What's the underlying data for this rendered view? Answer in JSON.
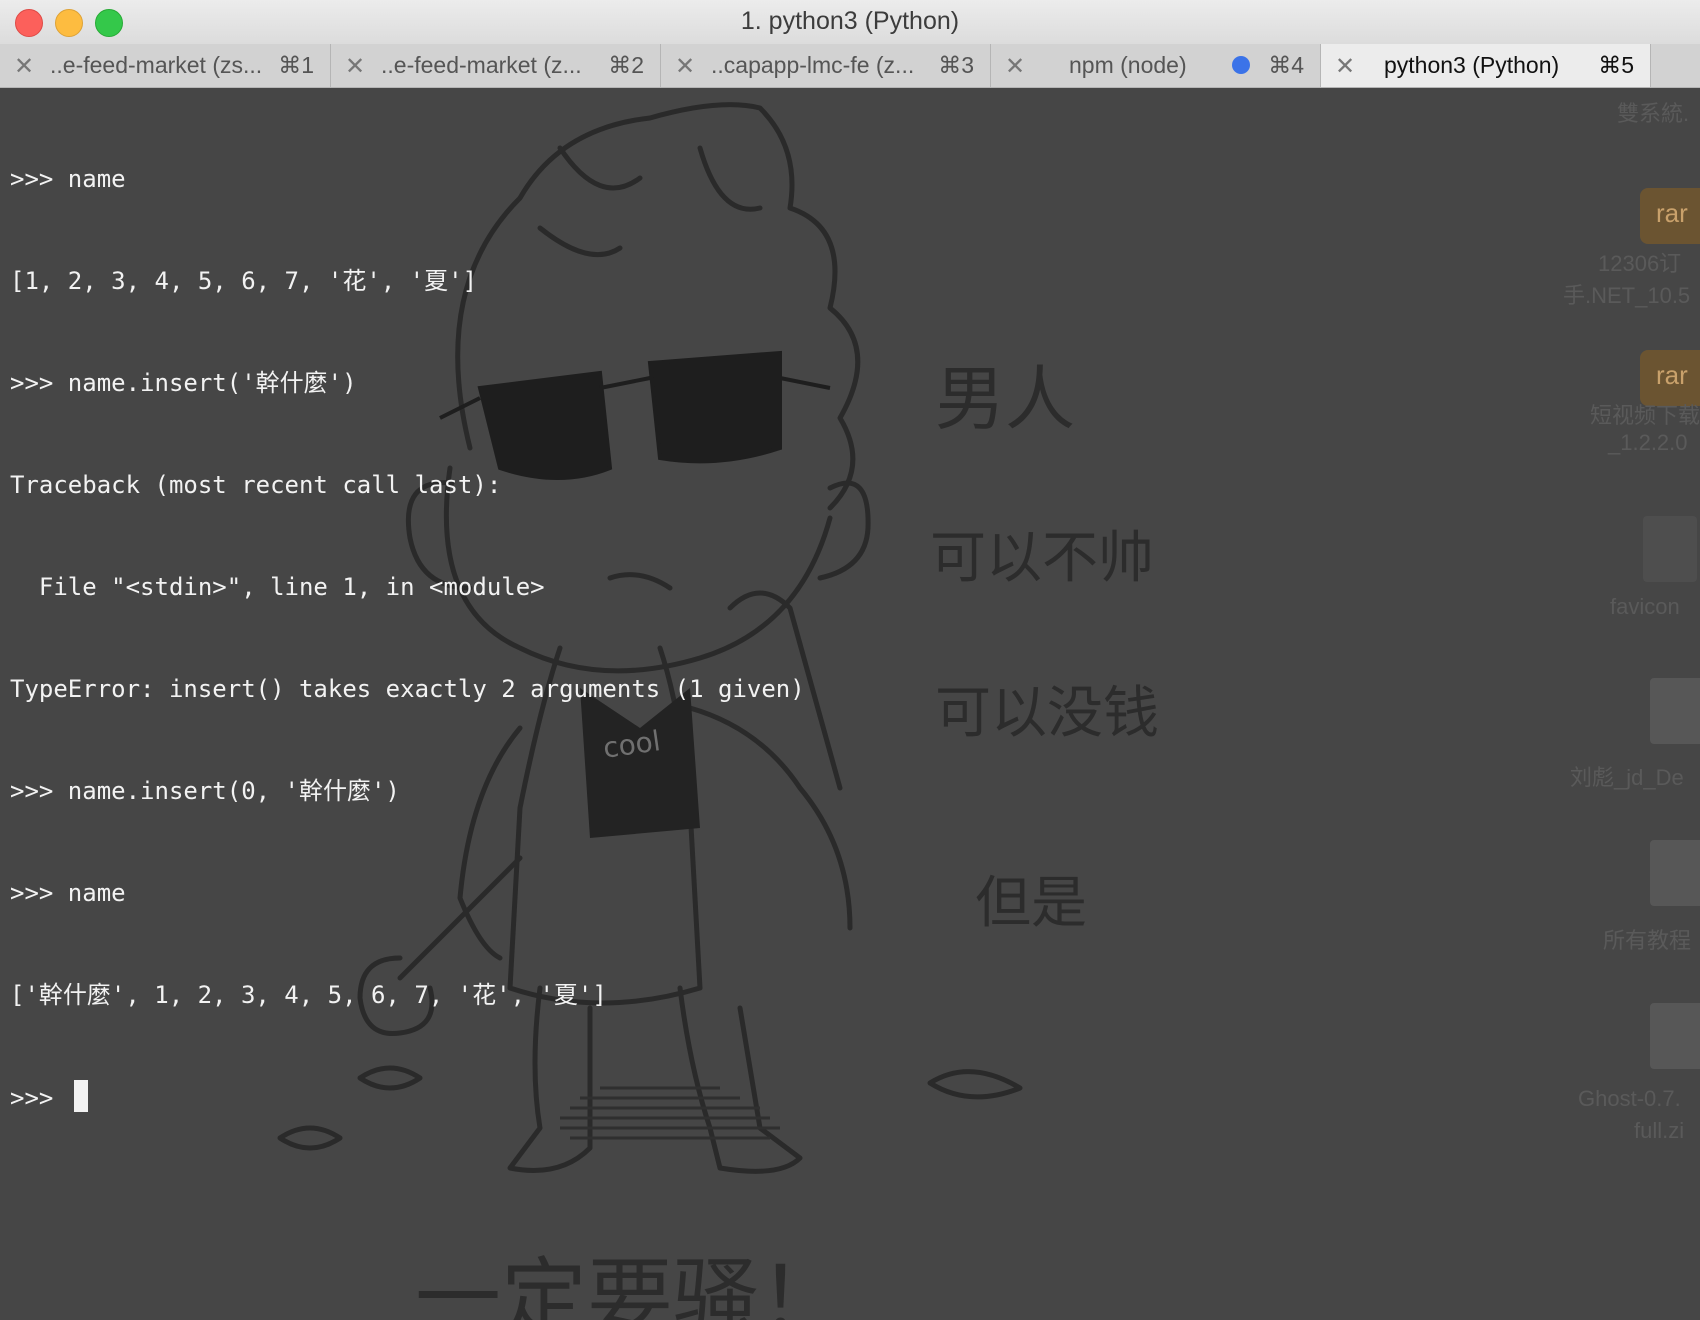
{
  "window": {
    "title": "1. python3 (Python)"
  },
  "tabs": [
    {
      "label": "..e-feed-market (zs...",
      "shortcut": "⌘1",
      "close": "✕",
      "active": false
    },
    {
      "label": "..e-feed-market (z...",
      "shortcut": "⌘2",
      "close": "✕",
      "active": false
    },
    {
      "label": "..capapp-lmc-fe (z...",
      "shortcut": "⌘3",
      "close": "✕",
      "active": false
    },
    {
      "label": "npm (node)",
      "shortcut": "⌘4",
      "close": "✕",
      "active": false,
      "activity_dot": true
    },
    {
      "label": "python3 (Python)",
      "shortcut": "⌘5",
      "close": "✕",
      "active": true
    }
  ],
  "terminal": {
    "lines": [
      ">>> name",
      "[1, 2, 3, 4, 5, 6, 7, '花', '夏']",
      ">>> name.insert('幹什麼')",
      "Traceback (most recent call last):",
      "  File \"<stdin>\", line 1, in <module>",
      "TypeError: insert() takes exactly 2 arguments (1 given)",
      ">>> name.insert(0, '幹什麼')",
      ">>> name",
      "['幹什麼', 1, 2, 3, 4, 5, 6, 7, '花', '夏']"
    ],
    "prompt": ">>> "
  },
  "background": {
    "texts": {
      "man": "男人",
      "not_handsome": "可以不帅",
      "no_money": "可以没钱",
      "but": "但是",
      "must": "一定要骚！",
      "shirt": "cool"
    }
  },
  "desktop": {
    "items": [
      {
        "label": "雙系統."
      },
      {
        "label": "rar"
      },
      {
        "label": "12306订"
      },
      {
        "label": "手.NET_10.5"
      },
      {
        "label": "rar"
      },
      {
        "label": "短视频下载"
      },
      {
        "label": "_1.2.2.0"
      },
      {
        "label": "favicon"
      },
      {
        "label": "刘彪_jd_De"
      },
      {
        "label": "所有教程"
      },
      {
        "label": "Ghost-0.7."
      },
      {
        "label": "full.zi"
      }
    ]
  },
  "colors": {
    "terminal_bg": "#464646",
    "terminal_fg": "#f2f2f2",
    "tab_active_bg": "#ececec",
    "tab_inactive_bg": "#d2d2d2",
    "activity_dot": "#3b73e8"
  }
}
